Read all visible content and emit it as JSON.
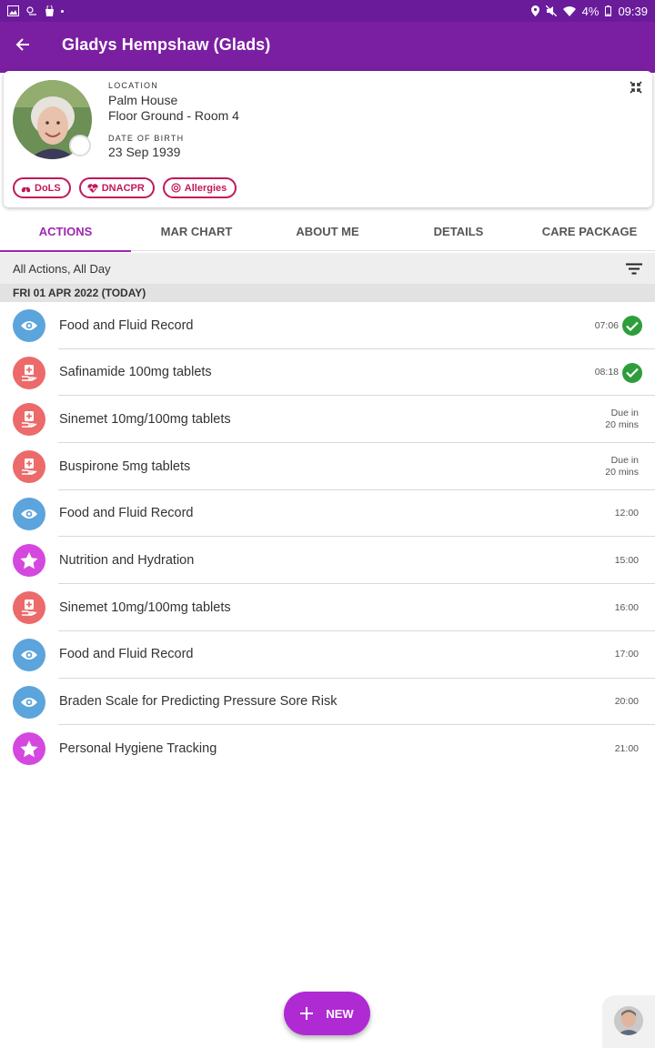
{
  "status_bar": {
    "battery": "4%",
    "time": "09:39",
    "icons": [
      "gallery-icon",
      "weather-icon",
      "bag-icon",
      "dot-icon",
      "location-icon",
      "mute-icon",
      "wifi-icon",
      "battery-icon"
    ]
  },
  "app_bar": {
    "title": "Gladys Hempshaw (Glads)",
    "back_icon": "arrow-back-icon"
  },
  "profile": {
    "location_label": "LOCATION",
    "location_line1": "Palm House",
    "location_line2": "Floor Ground - Room 4",
    "dob_label": "DATE OF BIRTH",
    "dob_value": "23 Sep 1939",
    "chips": [
      {
        "label": "DoLS",
        "icon": "lungs-icon"
      },
      {
        "label": "DNACPR",
        "icon": "heart-pulse-icon"
      },
      {
        "label": "Allergies",
        "icon": "allergy-icon"
      }
    ]
  },
  "tabs": [
    {
      "label": "ACTIONS",
      "active": true
    },
    {
      "label": "MAR CHART",
      "active": false
    },
    {
      "label": "ABOUT ME",
      "active": false
    },
    {
      "label": "DETAILS",
      "active": false
    },
    {
      "label": "CARE PACKAGE",
      "active": false
    }
  ],
  "filter": {
    "label": "All Actions, All Day",
    "icon": "filter-icon"
  },
  "date_header": "FRI 01 APR 2022 (TODAY)",
  "actions": [
    {
      "title": "Food and Fluid Record",
      "time": "07:06",
      "type": "observation",
      "done": true
    },
    {
      "title": "Safinamide 100mg tablets",
      "time": "08:18",
      "type": "medication",
      "done": true
    },
    {
      "title": "Sinemet 10mg/100mg tablets",
      "due_line1": "Due in",
      "due_line2": "20 mins",
      "type": "medication",
      "done": false
    },
    {
      "title": "Buspirone 5mg tablets",
      "due_line1": "Due in",
      "due_line2": "20 mins",
      "type": "medication",
      "done": false
    },
    {
      "title": "Food and Fluid Record",
      "time": "12:00",
      "type": "observation",
      "done": false
    },
    {
      "title": "Nutrition and Hydration",
      "time": "15:00",
      "type": "star",
      "done": false
    },
    {
      "title": "Sinemet 10mg/100mg tablets",
      "time": "16:00",
      "type": "medication",
      "done": false
    },
    {
      "title": "Food and Fluid Record",
      "time": "17:00",
      "type": "observation",
      "done": false
    },
    {
      "title": "Braden Scale for Predicting Pressure Sore Risk",
      "time": "20:00",
      "type": "observation",
      "done": false
    },
    {
      "title": "Personal Hygiene Tracking",
      "time": "21:00",
      "type": "star",
      "done": false
    }
  ],
  "fab": {
    "label": "NEW"
  },
  "colors": {
    "primary": "#7b1fa2",
    "accent": "#9c27b0",
    "observation": "#5ba4dc",
    "medication": "#ec6a6a",
    "star": "#d448e0",
    "done": "#2e9e3c",
    "chip": "#c2185b"
  }
}
